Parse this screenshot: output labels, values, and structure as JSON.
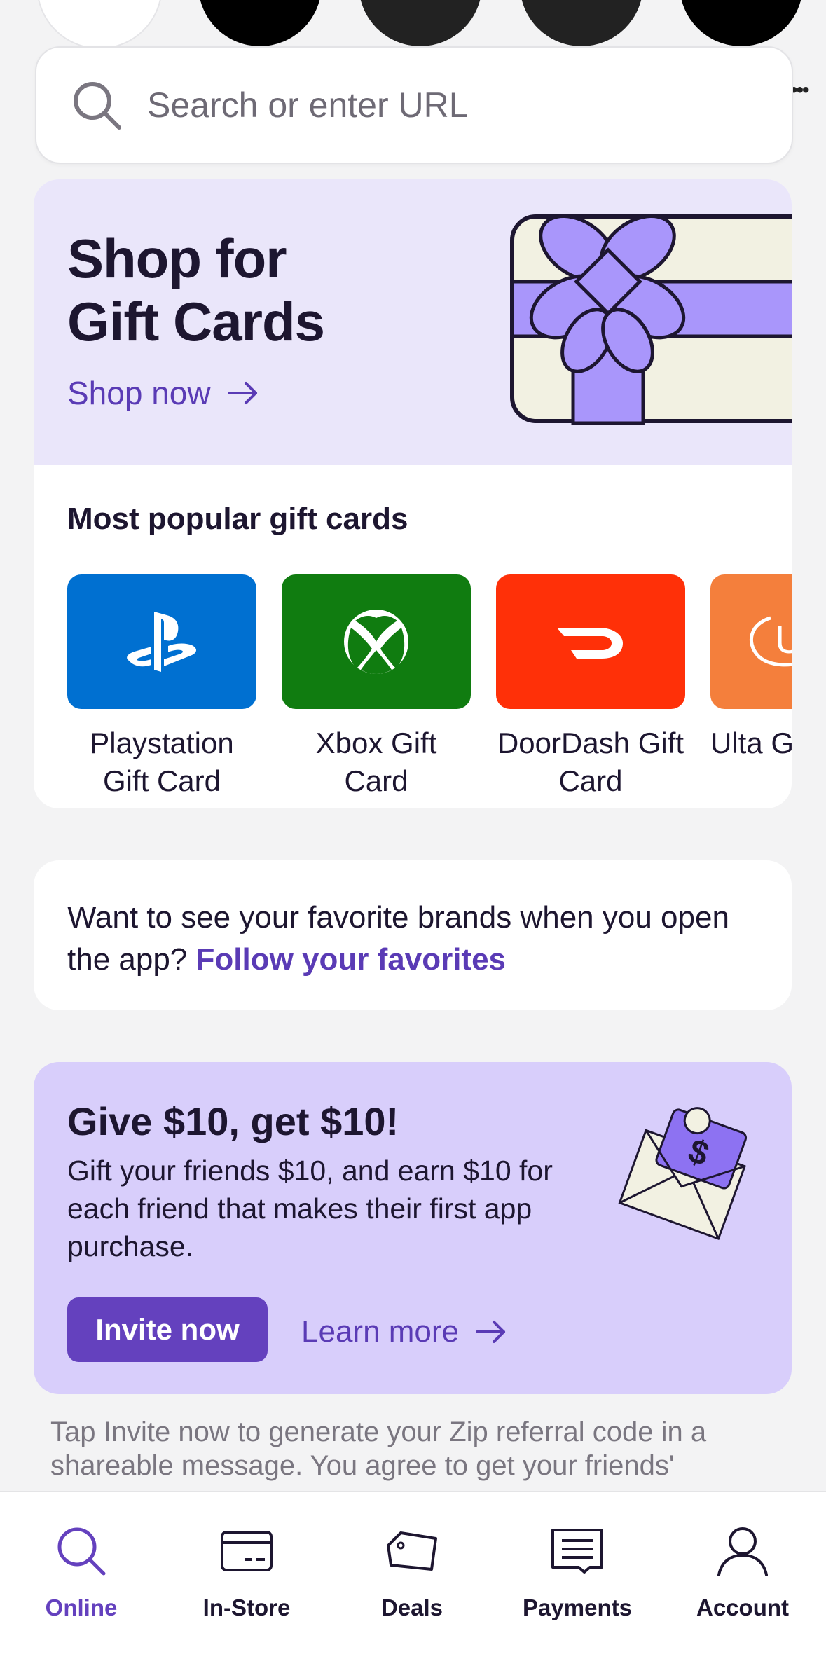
{
  "search": {
    "placeholder": "Search or enter URL"
  },
  "hero": {
    "title": "Shop for\nGift Cards",
    "cta": "Shop now"
  },
  "popular": {
    "title": "Most popular gift cards",
    "cards": [
      {
        "label": "Playstation Gift Card",
        "color": "#0070d1",
        "icon": "playstation-logo-icon"
      },
      {
        "label": "Xbox Gift Card",
        "color": "#107c10",
        "icon": "xbox-logo-icon"
      },
      {
        "label": "DoorDash Gift Card",
        "color": "#ff3008",
        "icon": "doordash-logo-icon"
      },
      {
        "label": "Ulta G",
        "color": "#f47f3c",
        "icon": "ulta-logo-icon"
      }
    ]
  },
  "follow": {
    "text": "Want to see your favorite brands when you open the app? ",
    "link": "Follow your favorites"
  },
  "referral": {
    "title": "Give $10, get $10!",
    "body": "Gift your friends $10, and earn $10 for each friend that makes their first app purchase.",
    "invite_label": "Invite now",
    "learn_more_label": "Learn more"
  },
  "disclaimer": "Tap Invite now to generate your Zip referral code in a shareable message. You agree to get your friends'",
  "nav": {
    "items": [
      {
        "label": "Online",
        "icon": "search-icon",
        "active": true
      },
      {
        "label": "In-Store",
        "icon": "card-icon",
        "active": false
      },
      {
        "label": "Deals",
        "icon": "tag-icon",
        "active": false
      },
      {
        "label": "Payments",
        "icon": "receipt-icon",
        "active": false
      },
      {
        "label": "Account",
        "icon": "person-icon",
        "active": false
      }
    ]
  },
  "colors": {
    "accent": "#6441be",
    "hero_bg": "#eae6fa",
    "referral_bg": "#d8cefb"
  }
}
